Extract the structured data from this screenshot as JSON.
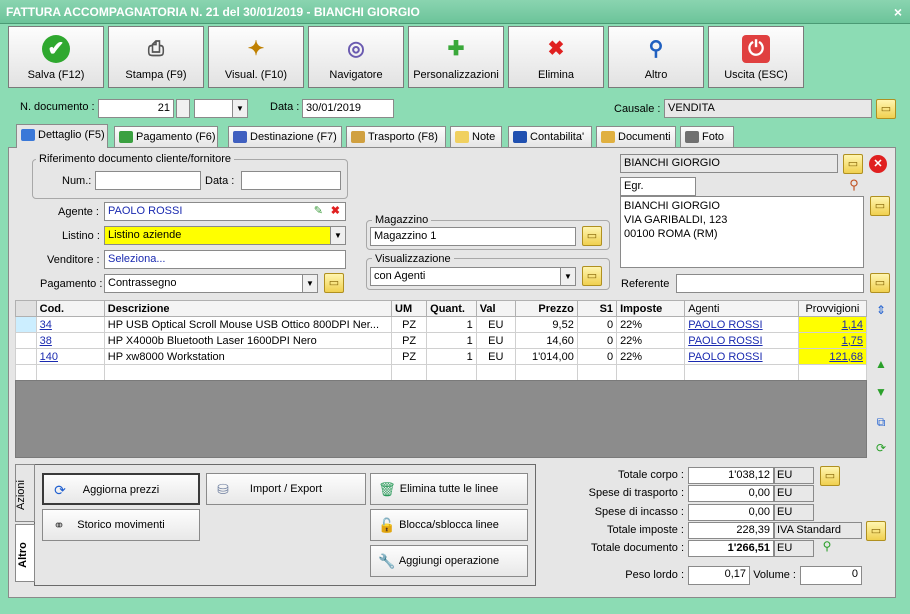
{
  "window": {
    "title": "FATTURA ACCOMPAGNATORIA N. 21 del 30/01/2019 - BIANCHI GIORGIO",
    "close": "×"
  },
  "toolbar": [
    {
      "label": "Salva (F12)",
      "icon": "✔"
    },
    {
      "label": "Stampa (F9)",
      "icon": "⎙"
    },
    {
      "label": "Visual. (F10)",
      "icon": "✦"
    },
    {
      "label": "Navigatore",
      "icon": "◎"
    },
    {
      "label": "Personalizzazioni",
      "icon": "✚"
    },
    {
      "label": "Elimina",
      "icon": "✖"
    },
    {
      "label": "Altro",
      "icon": "⚲"
    },
    {
      "label": "Uscita (ESC)",
      "icon": "⏻"
    }
  ],
  "header": {
    "ndoc_label": "N. documento :",
    "ndoc_value": "21",
    "data_label": "Data :",
    "data_value": "30/01/2019",
    "causale_label": "Causale :",
    "causale_value": "VENDITA"
  },
  "tabs": [
    {
      "label": "Dettaglio (F5)",
      "color": "#3a78d8"
    },
    {
      "label": "Pagamento (F6)",
      "color": "#3aa040"
    },
    {
      "label": "Destinazione (F7)",
      "color": "#4060c0"
    },
    {
      "label": "Trasporto (F8)",
      "color": "#d0a040"
    },
    {
      "label": "Note",
      "color": "#f0d060"
    },
    {
      "label": "Contabilita'",
      "color": "#2050b0"
    },
    {
      "label": "Documenti",
      "color": "#e0b040"
    },
    {
      "label": "Foto",
      "color": "#707070"
    }
  ],
  "rif": {
    "title": "Riferimento documento cliente/fornitore",
    "num_label": "Num.:",
    "num_value": "",
    "data_label": "Data :",
    "data_value": ""
  },
  "form": {
    "agente_label": "Agente :",
    "agente_value": "PAOLO ROSSI",
    "listino_label": "Listino :",
    "listino_value": "Listino aziende",
    "venditore_label": "Venditore :",
    "venditore_value": "Seleziona...",
    "pagamento_label": "Pagamento :",
    "pagamento_value": "Contrassegno"
  },
  "magazzino": {
    "title": "Magazzino",
    "value": "Magazzino 1"
  },
  "visualizzazione": {
    "title": "Visualizzazione",
    "value": "con Agenti"
  },
  "cliente": {
    "name": "BIANCHI GIORGIO",
    "code": "Egr.",
    "address": [
      "BIANCHI GIORGIO",
      "VIA GARIBALDI, 123",
      "00100 ROMA (RM)"
    ],
    "referente_label": "Referente",
    "referente_value": ""
  },
  "grid": {
    "headers": [
      "Cod.",
      "Descrizione",
      "UM",
      "Quant.",
      "Val",
      "Prezzo",
      "S1",
      "Imposte",
      "Agenti",
      "Provvigioni"
    ],
    "rows": [
      [
        "34",
        "HP USB Optical Scroll Mouse USB Ottico 800DPI Ner...",
        "PZ",
        "1",
        "EU",
        "9,52",
        "0",
        "22%",
        "PAOLO ROSSI",
        "1,14"
      ],
      [
        "38",
        "HP X4000b Bluetooth Laser 1600DPI Nero",
        "PZ",
        "1",
        "EU",
        "14,60",
        "0",
        "22%",
        "PAOLO ROSSI",
        "1,75"
      ],
      [
        "140",
        "HP xw8000 Workstation",
        "PZ",
        "1",
        "EU",
        "1'014,00",
        "0",
        "22%",
        "PAOLO ROSSI",
        "121,68"
      ]
    ]
  },
  "sidetabs": {
    "azioni": "Azioni",
    "altro": "Altro"
  },
  "actions": [
    "Aggiorna prezzi",
    "Import / Export",
    "Elimina tutte le linee",
    "Storico movimenti",
    "Blocca/sblocca linee",
    "Aggiungi operazione"
  ],
  "totals": {
    "corpo_label": "Totale corpo :",
    "corpo_value": "1'038,12",
    "corpo_unit": "EU",
    "trasporto_label": "Spese di trasporto :",
    "trasporto_value": "0,00",
    "trasporto_unit": "EU",
    "incasso_label": "Spese di incasso :",
    "incasso_value": "0,00",
    "incasso_unit": "EU",
    "imposte_label": "Totale imposte :",
    "imposte_value": "228,39",
    "imposte_unit": "IVA Standard",
    "documento_label": "Totale documento :",
    "documento_value": "1'266,51",
    "documento_unit": "EU",
    "peso_label": "Peso lordo :",
    "peso_value": "0,17",
    "volume_label": "Volume :",
    "volume_value": "0"
  }
}
